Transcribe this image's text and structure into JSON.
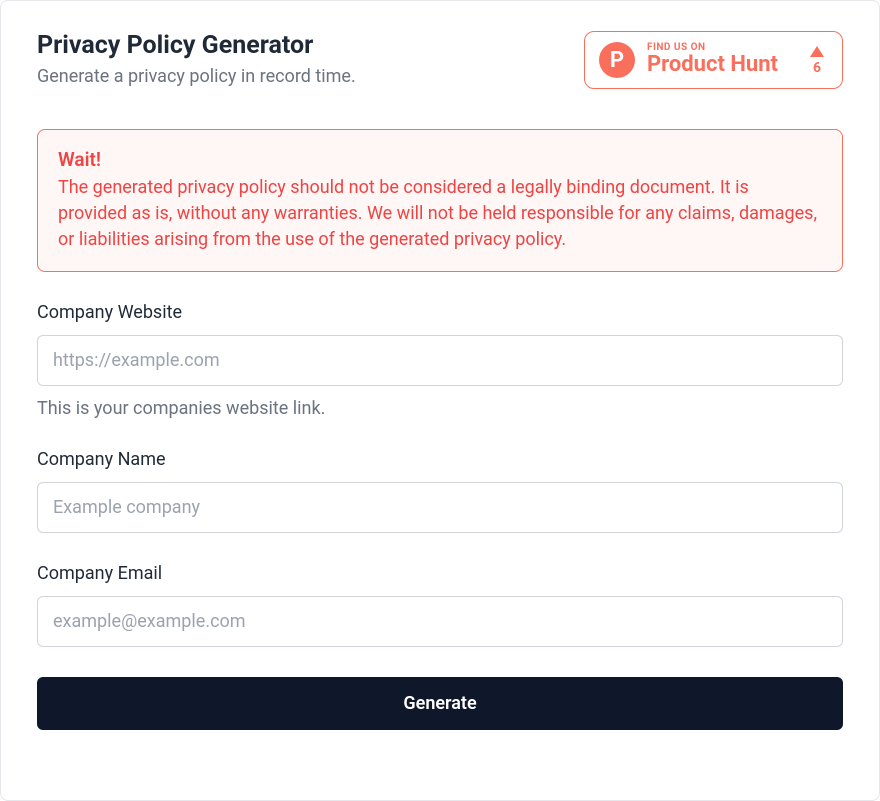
{
  "header": {
    "title": "Privacy Policy Generator",
    "subtitle": "Generate a privacy policy in record time."
  },
  "product_hunt": {
    "find_label": "FIND US ON",
    "name": "Product Hunt",
    "logo_letter": "P",
    "votes": "6"
  },
  "alert": {
    "title": "Wait!",
    "body": "The generated privacy policy should not be considered a legally binding document. It is provided as is, without any warranties. We will not be held responsible for any claims, damages, or liabilities arising from the use of the generated privacy policy."
  },
  "fields": {
    "website": {
      "label": "Company Website",
      "placeholder": "https://example.com",
      "help": "This is your companies website link."
    },
    "name": {
      "label": "Company Name",
      "placeholder": "Example company"
    },
    "email": {
      "label": "Company Email",
      "placeholder": "example@example.com"
    }
  },
  "actions": {
    "generate": "Generate"
  }
}
